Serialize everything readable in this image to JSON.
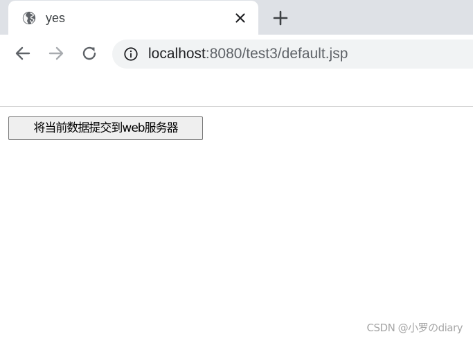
{
  "browser": {
    "tab": {
      "title": "yes",
      "favicon": "globe-icon",
      "close": "close-icon"
    },
    "new_tab": "plus-icon",
    "nav": {
      "back": "arrow-left-icon",
      "forward": "arrow-right-icon",
      "reload": "reload-icon"
    },
    "address_bar": {
      "icon": "info-icon",
      "host": "localhost",
      "rest": ":8080/test3/default.jsp"
    },
    "colors": {
      "tabstrip": "#dee1e6",
      "omnibox": "#f1f3f4",
      "icon": "#5f6368",
      "icon_disabled": "#a8abaf"
    }
  },
  "page": {
    "submit_button_label": "将当前数据提交到web服务器"
  },
  "watermark": "CSDN @小罗のdiary"
}
